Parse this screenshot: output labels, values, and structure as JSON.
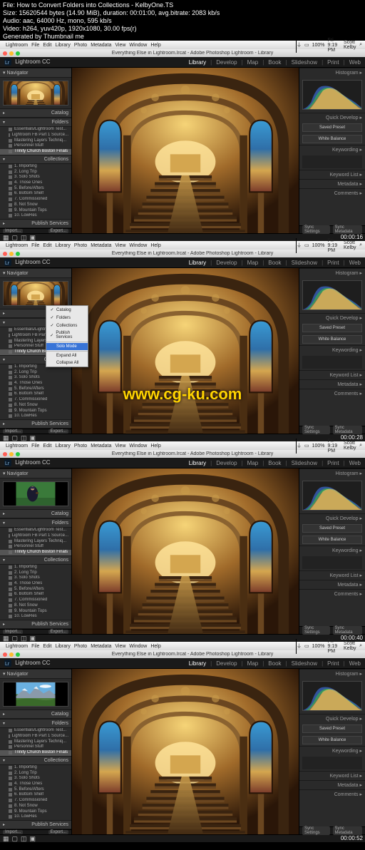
{
  "meta": {
    "file": "File: How to Convert Folders into Collections - KelbyOne.TS",
    "size": "Size: 15620544 bytes (14.90 MiB), duration: 00:01:00, avg.bitrate: 2083 kb/s",
    "audio": "Audio: aac, 64000 Hz, mono, 595 kb/s",
    "video": "Video: h264, yuv420p, 1920x1080, 30.00 fps(r)",
    "gen": "Generated by Thumbnail me"
  },
  "watermark": "www.cg-ku.com",
  "mac": {
    "menus": [
      "Lightroom",
      "File",
      "Edit",
      "Library",
      "Photo",
      "Metadata",
      "View",
      "Window",
      "Help"
    ],
    "right": [
      "100%",
      "Fri 9:19 PM",
      "Scott Kelby"
    ],
    "title": "Everything Else in Lightroom.lrcat - Adobe Photoshop Lightroom - Library"
  },
  "lr": {
    "logo": "Lightroom CC",
    "tabs": [
      "Library",
      "Develop",
      "Map",
      "Book",
      "Slideshow",
      "Print",
      "Web"
    ],
    "left": {
      "catalog": "Catalog",
      "folders": "Folders",
      "folder_items": [
        "Essentials/Lightroom Test...",
        "Lightroom FB Part 1 Source...",
        "Mastering Layers Techniq...",
        "Personnel Stuff",
        "Trinity Church Boston Finals"
      ],
      "collections": "Collections",
      "coll_items": [
        "1. Importing",
        "2. Long Trip",
        "3. Solo Shots",
        "4. Those Ones",
        "5. Before/Afters",
        "6. Bottom Shelf",
        "7. Commissioned",
        "8. Not Snow",
        "9. Mountain Tops",
        "10. LowRes"
      ],
      "publish": "Publish Services",
      "import": "Import...",
      "export": "Export..."
    },
    "right": {
      "histogram": "Histogram ▸",
      "quickdev": "Quick Develop ▸",
      "keywording": "Keywording ▸",
      "keywordlist": "Keyword List ▸",
      "metadata": "Metadata ▸",
      "comments": "Comments ▸",
      "saved": "Saved Preset",
      "wb": "White Balance",
      "sync": "Sync Settings",
      "syncm": "Sync Metadata"
    },
    "ctx": {
      "items": [
        "Catalog",
        "Folders",
        "Collections",
        "Publish Services"
      ],
      "solo": "Solo Mode",
      "expand": "Expand All",
      "collapse": "Collapse All"
    }
  },
  "timestamps": [
    "00:00:16",
    "00:00:28",
    "00:00:40",
    "00:00:52"
  ]
}
